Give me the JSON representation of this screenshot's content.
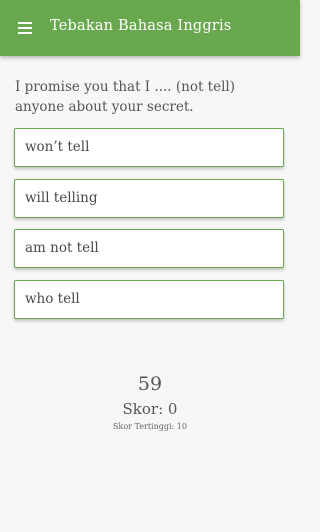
{
  "app_bar": {
    "title": "Tebakan Bahasa Inggris",
    "menu_icon": "hamburger-menu-icon",
    "background_color": "#6aa84f"
  },
  "quiz": {
    "question": "I promise you that I .... (not tell) anyone about your secret.",
    "options": [
      {
        "label": "won’t tell"
      },
      {
        "label": "will telling"
      },
      {
        "label": "am not tell"
      },
      {
        "label": "who tell"
      }
    ],
    "option_border_color": "#6aa84f"
  },
  "status": {
    "timer": "59",
    "score": "Skor: 0",
    "high_score": "Skor Tertinggi: 10"
  }
}
